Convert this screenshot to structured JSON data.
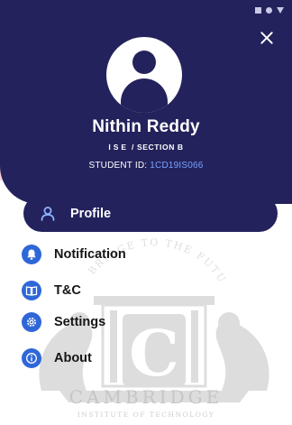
{
  "colors": {
    "header_bg": "#23225c",
    "icon_blue": "#2f67d9",
    "id_accent": "#7aa3ff",
    "active_item_bg": "#23225c"
  },
  "status_bar": {
    "icons": [
      "square-icon",
      "circle-icon",
      "triangle-icon"
    ]
  },
  "profile": {
    "name": "Nithin Reddy",
    "branch": "ISE",
    "section": "/ SECTION B",
    "student_id_label": "STUDENT ID:",
    "student_id_value": "1CD19IS066"
  },
  "menu": {
    "items": [
      {
        "label": "Profile",
        "icon": "person-icon",
        "active": true
      },
      {
        "label": "Notification",
        "icon": "bell-icon",
        "active": false
      },
      {
        "label": "T&C",
        "icon": "book-icon",
        "active": false
      },
      {
        "label": "Settings",
        "icon": "gear-icon",
        "active": false
      },
      {
        "label": "About",
        "icon": "info-icon",
        "active": false
      }
    ]
  },
  "watermark": {
    "motto": "BRIDGE TO THE FUTURE",
    "name": "CAMBRIDGE",
    "subtitle": "INSTITUTE OF TECHNOLOGY"
  }
}
